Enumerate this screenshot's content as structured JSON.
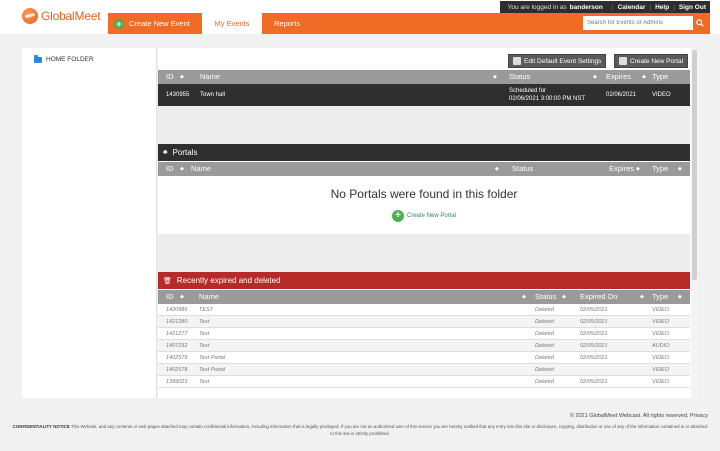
{
  "brand": {
    "logo_text": "GlobalMeet",
    "accent_color": "#ef6b26"
  },
  "userbar": {
    "logged_in_prefix": "You are logged in as",
    "username": "banderson",
    "links": [
      "Calendar",
      "Help",
      "Sign Out"
    ]
  },
  "nav": {
    "create_event": "Create New Event",
    "my_events": "My Events",
    "reports": "Reports",
    "search_placeholder": "Search for Events or Admins"
  },
  "tree": {
    "home_folder": "HOME FOLDER"
  },
  "toolbar": {
    "edit_defaults": "Edit Default Event Settings",
    "create_portal": "Create New Portal"
  },
  "events": {
    "headers": {
      "id": "ID",
      "name": "Name",
      "status": "Status",
      "expires": "Expires",
      "type": "Type"
    },
    "row": {
      "id": "1430955",
      "name": "Town hall",
      "status_line1": "Scheduled for",
      "status_line2": "02/06/2021 3:00:00 PM NST",
      "expires": "02/06/2021",
      "type": "VIDEO"
    }
  },
  "portals": {
    "title": "Portals",
    "headers": {
      "id": "ID",
      "name": "Name",
      "status": "Status",
      "expires": "Expires",
      "type": "Type"
    },
    "empty_message": "No Portals were found in this folder",
    "create_link": "Create New Portal"
  },
  "expired": {
    "title": "Recently expired and deleted",
    "bar_color": "#b52b27",
    "headers": {
      "id": "ID",
      "name": "Name",
      "status": "Status",
      "expired_on": "Expired On",
      "type": "Type"
    },
    "rows": [
      {
        "id": "1420986",
        "name": "TEST",
        "status": "Deleted",
        "expired_on": "02/05/2021",
        "type": "VIDEO"
      },
      {
        "id": "1421280",
        "name": "Test",
        "status": "Deleted",
        "expired_on": "02/05/2021",
        "type": "VIDEO"
      },
      {
        "id": "1421277",
        "name": "Test",
        "status": "Deleted",
        "expired_on": "02/05/2021",
        "type": "VIDEO"
      },
      {
        "id": "1407232",
        "name": "Test",
        "status": "Deleted",
        "expired_on": "02/05/2021",
        "type": "AUDIO"
      },
      {
        "id": "1402579",
        "name": "Test Portal",
        "status": "Deleted",
        "expired_on": "02/05/2021",
        "type": "VIDEO"
      },
      {
        "id": "1402578",
        "name": "Test Portal",
        "status": "Deleted",
        "expired_on": "",
        "type": "VIDEO"
      },
      {
        "id": "1399023",
        "name": "Test",
        "status": "Deleted",
        "expired_on": "02/05/2021",
        "type": "VIDEO"
      }
    ]
  },
  "footer": {
    "copyright": "© 2021 GlobalMeet Webcast. All rights reserved. Privacy",
    "notice_label": "CONFIDENTIALITY NOTICE",
    "notice_text": "This Website, and any contents or web pages attached may contain confidential information, including information that is legally privileged. If you are not an authorized user of this service you are hereby notified that any entry into this site or disclosure, copying, distribution or use of any of the information contained in or attached to this site is strictly prohibited."
  }
}
